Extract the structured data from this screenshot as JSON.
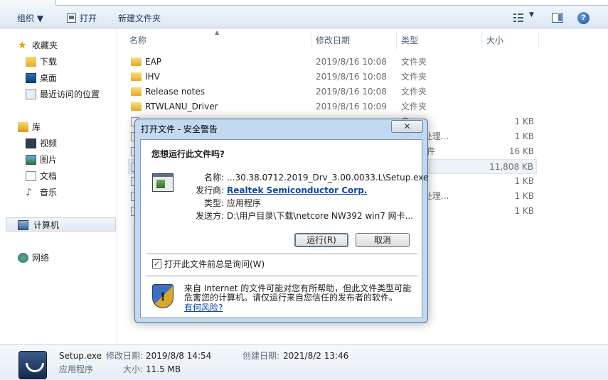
{
  "toolbar": {
    "organize_label": "组织 ▼",
    "open_label": "打开",
    "new_folder_label": "新建文件夹",
    "view_caret": "▼",
    "help_glyph": "?"
  },
  "nav": {
    "favorites": {
      "title": "收藏夹",
      "items": [
        "下载",
        "桌面",
        "最近访问的位置"
      ]
    },
    "libraries": {
      "title": "库",
      "items": [
        "视频",
        "图片",
        "文档",
        "音乐"
      ]
    },
    "computer": "计算机",
    "network": "网络"
  },
  "columns": {
    "name": "名称",
    "date": "修改日期",
    "type": "类型",
    "size": "大小"
  },
  "files": [
    {
      "name": "EAP",
      "date": "2019/8/16 10:08",
      "type": "文件夹",
      "size": ""
    },
    {
      "name": "IHV",
      "date": "2019/8/16 10:08",
      "type": "文件夹",
      "size": ""
    },
    {
      "name": "Release notes",
      "date": "2019/8/16 10:08",
      "type": "文件夹",
      "size": ""
    },
    {
      "name": "RTWLANU_Driver",
      "date": "2019/8/16 10:09",
      "type": "文件夹",
      "size": ""
    },
    {
      "name": "",
      "date": "",
      "type": "息",
      "size": "1 KB"
    },
    {
      "name": "",
      "date": "",
      "type": "ws 批处理...",
      "size": "1 KB"
    },
    {
      "name": "",
      "date": "",
      "type": "用片文件",
      "size": "16 KB"
    },
    {
      "name": "",
      "date": "",
      "type": "序",
      "size": "11,808 KB"
    },
    {
      "name": "",
      "date": "",
      "type": "件",
      "size": "1 KB"
    },
    {
      "name": "",
      "date": "",
      "type": "ws 批处理...",
      "size": "1 KB"
    },
    {
      "name": "",
      "date": "",
      "type": "件",
      "size": "1 KB"
    }
  ],
  "details": {
    "filename": "Setup.exe",
    "filetype": "应用程序",
    "modified_label": "修改日期:",
    "modified_value": "2019/8/8 14:54",
    "created_label": "创建日期:",
    "created_value": "2021/8/2 13:46",
    "size_label": "大小:",
    "size_value": "11.5 MB"
  },
  "dialog": {
    "title": "打开文件 - 安全警告",
    "close_glyph": "✕",
    "question": "您想运行此文件吗?",
    "name_label": "名称:",
    "name_value": "...30.38.0712.2019_Drv_3.00.0033.L\\Setup.exe",
    "publisher_label": "发行商:",
    "publisher_value": "Realtek Semiconductor Corp.",
    "type_label": "类型:",
    "type_value": "应用程序",
    "from_label": "发送方:",
    "from_value": "D:\\用户目录\\下载\\netcore NW392 win7 网卡...",
    "run_button": "运行(R)",
    "cancel_button": "取消",
    "checkbox_mark": "✓",
    "checkbox_label": "打开此文件前总是询问(W)",
    "warning_text": "来自 Internet 的文件可能对您有所帮助，但此文件类型可能危害您的计算机。请仅运行来自您信任的发布者的软件。",
    "risk_link": "有何风险?",
    "shield_mark": "!"
  }
}
